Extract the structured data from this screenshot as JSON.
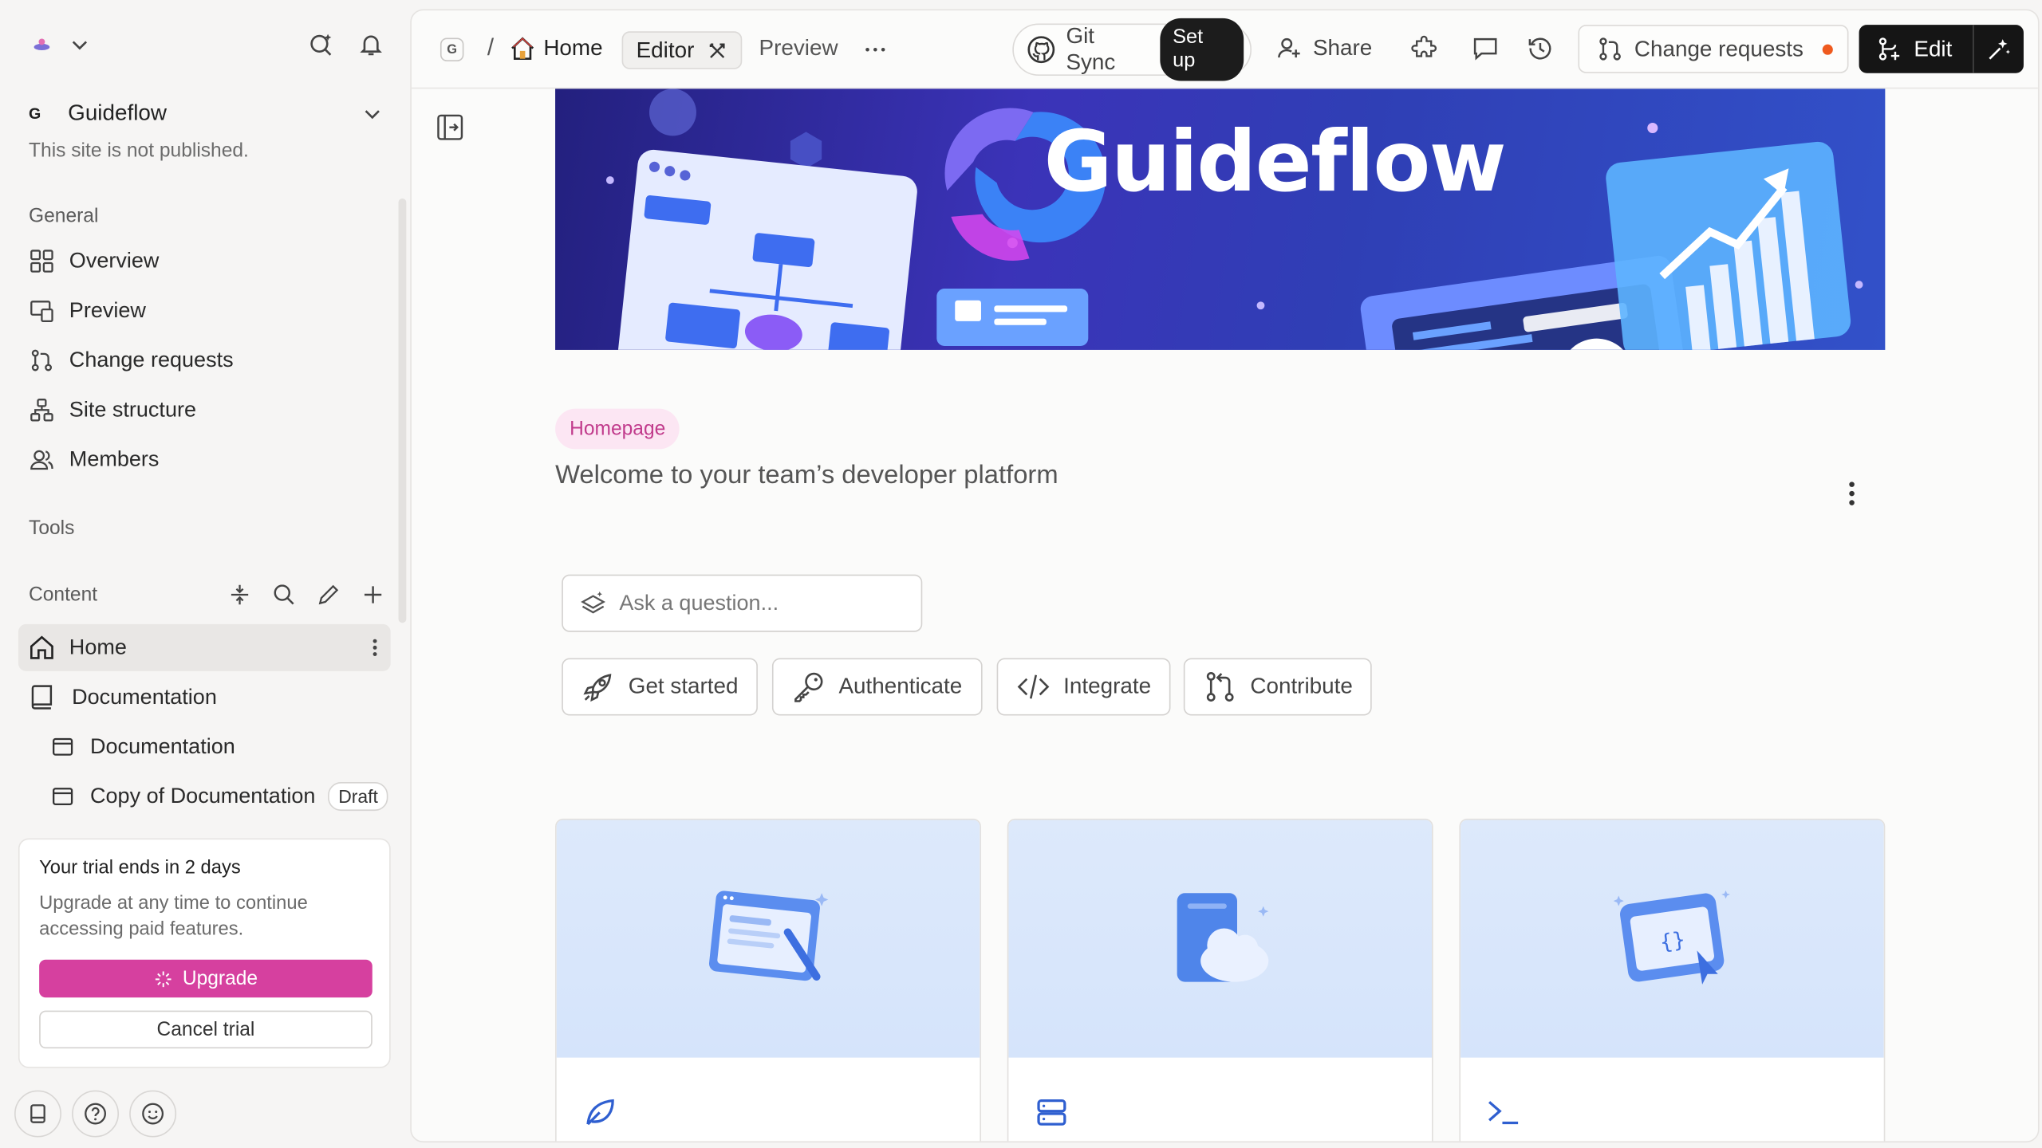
{
  "sidebar": {
    "site": {
      "badge": "G",
      "name": "Guideflow",
      "status": "This site is not published."
    },
    "sections": {
      "general": "General",
      "tools": "Tools",
      "content": "Content"
    },
    "general_items": [
      {
        "label": "Overview",
        "icon": "grid-icon"
      },
      {
        "label": "Preview",
        "icon": "preview-icon"
      },
      {
        "label": "Change requests",
        "icon": "branch-icon"
      },
      {
        "label": "Site structure",
        "icon": "sitemap-icon"
      },
      {
        "label": "Members",
        "icon": "members-icon"
      }
    ],
    "content_items": [
      {
        "label": "Home",
        "icon": "home-icon",
        "active": true
      },
      {
        "label": "Documentation",
        "icon": "book-icon"
      },
      {
        "label": "Documentation",
        "icon": "window-icon"
      },
      {
        "label": "Copy of Documentation",
        "icon": "window-icon",
        "badge": "Draft"
      }
    ],
    "trial": {
      "title": "Your trial ends in 2 days",
      "body": "Upgrade at any time to continue accessing paid features.",
      "upgrade": "Upgrade",
      "cancel": "Cancel trial"
    }
  },
  "topbar": {
    "space_badge": "G",
    "breadcrumb_sep": "/",
    "page": "Home",
    "editor_tab": "Editor",
    "preview_tab": "Preview",
    "git_sync": "Git Sync",
    "setup": "Set up",
    "share": "Share",
    "change_requests": "Change requests",
    "edit": "Edit"
  },
  "page": {
    "hero_text": "Guideflow",
    "tag": "Homepage",
    "subtitle": "Welcome to your team’s developer platform",
    "ask_placeholder": "Ask a question...",
    "quick_links": [
      "Get started",
      "Authenticate",
      "Integrate",
      "Contribute"
    ]
  },
  "colors": {
    "accent_pink": "#d6409f",
    "change_dot": "#ef5a1e",
    "edit_bg": "#151515"
  }
}
